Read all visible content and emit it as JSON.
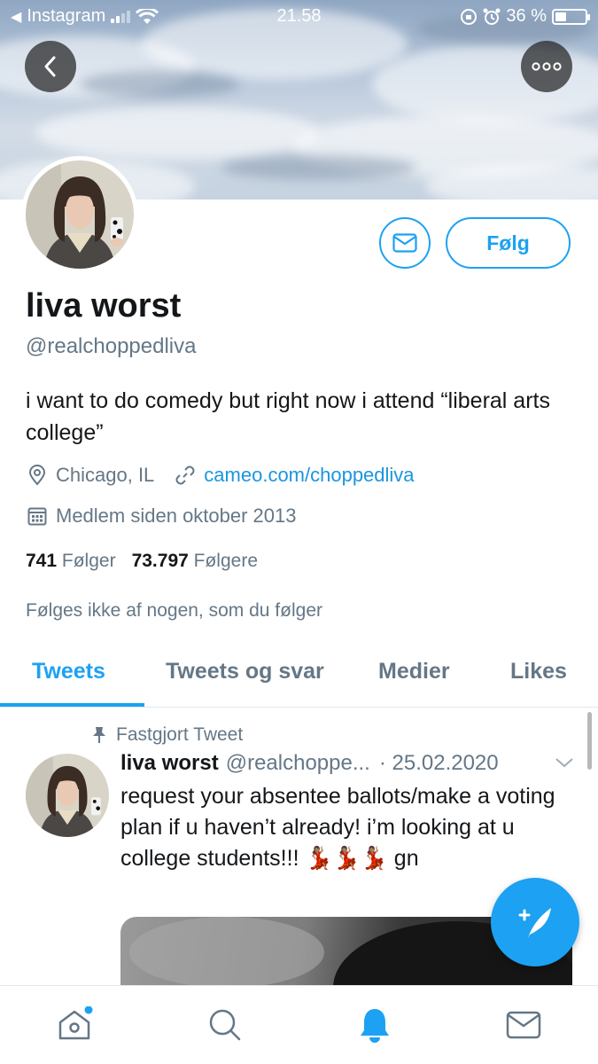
{
  "status_bar": {
    "back_app": "Instagram",
    "time": "21.58",
    "battery": "36 %",
    "battery_level": 0.36
  },
  "profile": {
    "name": "liva worst",
    "handle": "@realchoppedliva",
    "bio": "i want to do comedy but right now i attend “liberal arts college”",
    "location": "Chicago, IL",
    "website": "cameo.com/choppedliva",
    "joined": "Medlem siden oktober 2013",
    "following_count": "741",
    "following_label": "Følger",
    "followers_count": "73.797",
    "followers_label": "Følgere",
    "followed_by": "Følges ikke af nogen, som du følger",
    "follow_button": "Følg"
  },
  "tabs": [
    {
      "label": "Tweets",
      "active": true
    },
    {
      "label": "Tweets og svar",
      "active": false
    },
    {
      "label": "Medier",
      "active": false
    },
    {
      "label": "Likes",
      "active": false
    }
  ],
  "pinned_tweet": {
    "pinned_label": "Fastgjort Tweet",
    "name": "liva worst",
    "handle": "@realchoppe...",
    "date": "· 25.02.2020",
    "text": "request your absentee ballots/make a voting plan if u haven’t already! i’m looking at u college students!!! 💃🏽💃🏽💃🏽 gn"
  },
  "icons": {
    "back": "chevron-left-icon",
    "more": "more-icon",
    "message": "envelope-icon",
    "location": "location-pin-icon",
    "link": "link-icon",
    "calendar": "calendar-icon",
    "pin": "pin-icon",
    "compose": "compose-tweet-icon",
    "nav_home": "home-icon",
    "nav_search": "search-icon",
    "nav_notifications": "bell-icon",
    "nav_messages": "envelope-icon"
  },
  "colors": {
    "accent": "#1da1f2",
    "link": "#1b95e0",
    "secondary_text": "#657786"
  }
}
